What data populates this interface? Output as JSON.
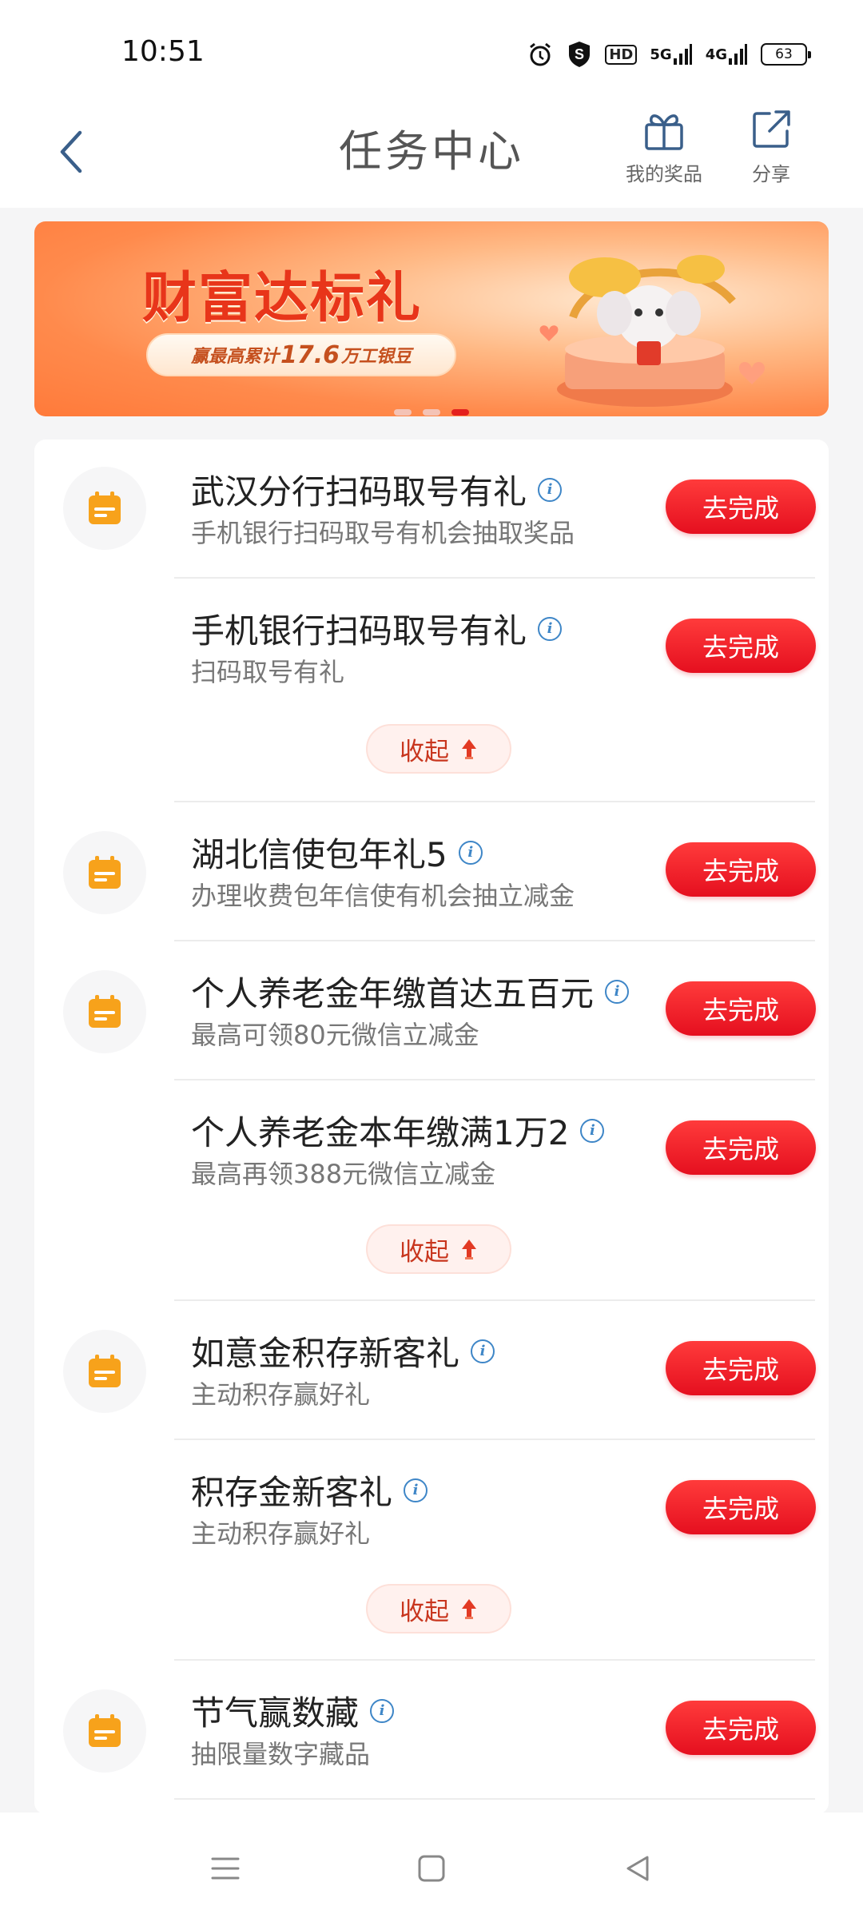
{
  "status_bar": {
    "time": "10:51",
    "hd_label": "HD",
    "net1": "5G",
    "net2": "4G",
    "battery": "63"
  },
  "header": {
    "title": "任务中心",
    "prizes_label": "我的奖品",
    "share_label": "分享"
  },
  "banner": {
    "title": "财富达标礼",
    "pill_prefix": "赢最高累计",
    "pill_amount": "17.6",
    "pill_suffix": "万工银豆",
    "dots": 3,
    "active_dot": 2
  },
  "colors": {
    "accent_red": "#e50f1f",
    "icon_orange": "#f7a21b",
    "info_blue": "#3e86c7"
  },
  "tasks": [
    {
      "title": "武汉分行扫码取号有礼",
      "subtitle": "手机银行扫码取号有机会抽取奖品",
      "button": "去完成",
      "has_icon": true
    },
    {
      "title": "手机银行扫码取号有礼",
      "subtitle": "扫码取号有礼",
      "button": "去完成",
      "has_icon": false
    },
    {
      "title": "湖北信使包年礼5",
      "subtitle": "办理收费包年信使有机会抽立减金",
      "button": "去完成",
      "has_icon": true
    },
    {
      "title": "个人养老金年缴首达五百元",
      "subtitle": "最高可领80元微信立减金",
      "button": "去完成",
      "has_icon": true
    },
    {
      "title": "个人养老金本年缴满1万2",
      "subtitle": "最高再领388元微信立减金",
      "button": "去完成",
      "has_icon": false
    },
    {
      "title": "如意金积存新客礼",
      "subtitle": "主动积存赢好礼",
      "button": "去完成",
      "has_icon": true
    },
    {
      "title": "积存金新客礼",
      "subtitle": "主动积存赢好礼",
      "button": "去完成",
      "has_icon": false
    },
    {
      "title": "节气赢数藏",
      "subtitle": "抽限量数字藏品",
      "button": "去完成",
      "has_icon": true
    }
  ],
  "collapse_label": "收起"
}
